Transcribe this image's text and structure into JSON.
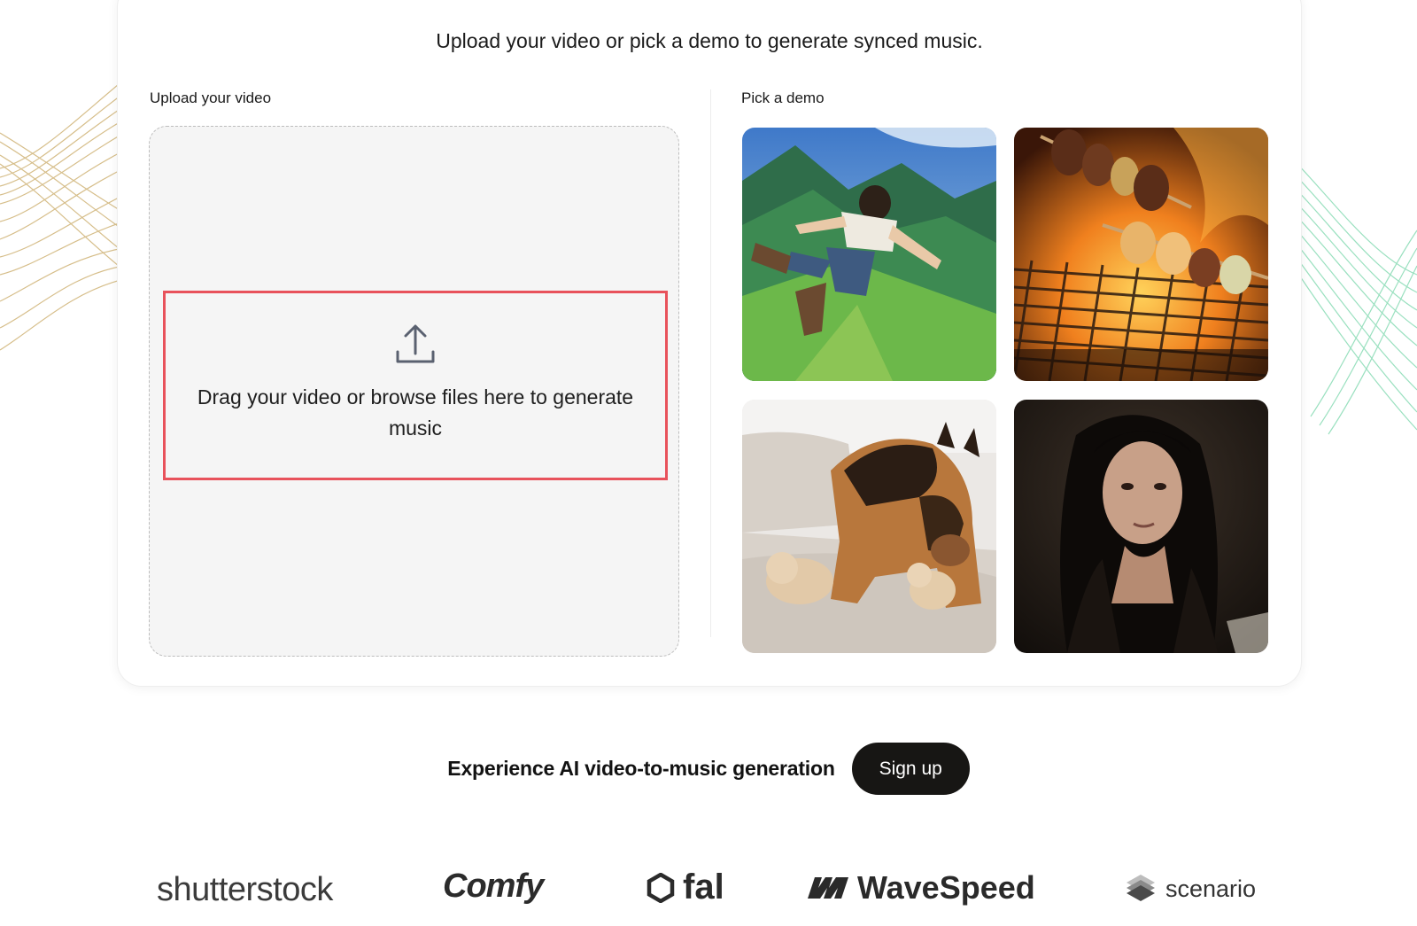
{
  "card": {
    "title": "Upload your video or pick a demo to generate synced music.",
    "upload_label": "Upload your video",
    "dropzone_text": "Drag your video or browse files here to generate music",
    "demo_label": "Pick a demo",
    "demos": [
      {
        "icon": "anime-boy-flying-over-mountains"
      },
      {
        "icon": "grilled-skewers-over-flames"
      },
      {
        "icon": "german-shepherd-with-kittens"
      },
      {
        "icon": "woman-crying-dark-scene"
      }
    ]
  },
  "cta": {
    "text": "Experience AI video-to-music generation",
    "button_label": "Sign up"
  },
  "partners": [
    "shutterstock",
    "Comfy",
    "fal",
    "WaveSpeed",
    "scenario"
  ],
  "colors": {
    "highlight_border": "#e8525b",
    "button_bg": "#171614",
    "dropzone_bg": "#f5f5f5",
    "deco_left": "#c9a964",
    "deco_right": "#6fd3a4"
  }
}
